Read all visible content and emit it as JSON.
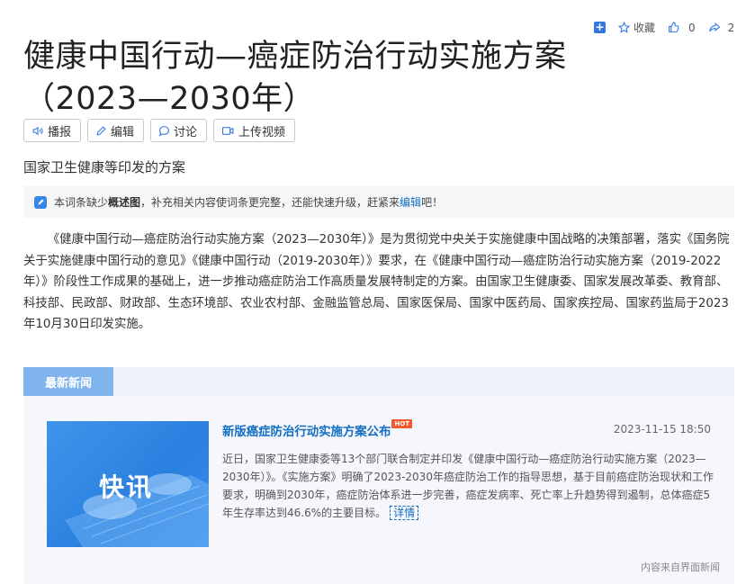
{
  "toolbar": {
    "collect_label": "收藏",
    "like_count": "0",
    "share_count": "2"
  },
  "page_title": "健康中国行动—癌症防治行动实施方案（2023—2030年）",
  "actions": {
    "broadcast": "播报",
    "edit": "编辑",
    "discuss": "讨论",
    "upload_video": "上传视频"
  },
  "subtitle": "国家卫生健康等印发的方案",
  "notice": {
    "prefix": "本词条缺少",
    "bold": "概述图",
    "middle": "，补充相关内容使词条更完整，还能快速升级，赶紧来",
    "link": "编辑",
    "suffix": "吧！"
  },
  "intro": "《健康中国行动—癌症防治行动实施方案（2023—2030年）》是为贯彻党中央关于实施健康中国战略的决策部署，落实《国务院关于实施健康中国行动的意见》《健康中国行动（2019-2030年）》要求，在《健康中国行动—癌症防治行动实施方案（2019-2022年）》阶段性工作成果的基础上，进一步推动癌症防治工作高质量发展特制定的方案。由国家卫生健康委、国家发展改革委、教育部、科技部、民政部、财政部、生态环境部、农业农村部、金融监管总局、国家医保局、国家中医药局、国家疾控局、国家药监局于2023年10月30日印发实施。",
  "news": {
    "tab_label": "最新新闻",
    "thumb_text": "快讯",
    "title": "新版癌症防治行动实施方案公布",
    "hot_badge": "HOT",
    "date": "2023-11-15 18:50",
    "body": "近日，国家卫生健康委等13个部门联合制定并印发《健康中国行动—癌症防治行动实施方案（2023—2030年）》。《实施方案》明确了2023-2030年癌症防治工作的指导思想，基于目前癌症防治现状和工作要求，明确到2030年，癌症防治体系进一步完善，癌症发病率、死亡率上升趋势得到遏制，总体癌症5年生存率达到46.6%的主要目标。",
    "detail_link": "详情",
    "source": "内容来自界面新闻"
  },
  "colors": {
    "link": "#136ec2",
    "tab": "#7fb4ec",
    "hot": "#ef5a2c",
    "icon_blue": "#3477e0"
  }
}
